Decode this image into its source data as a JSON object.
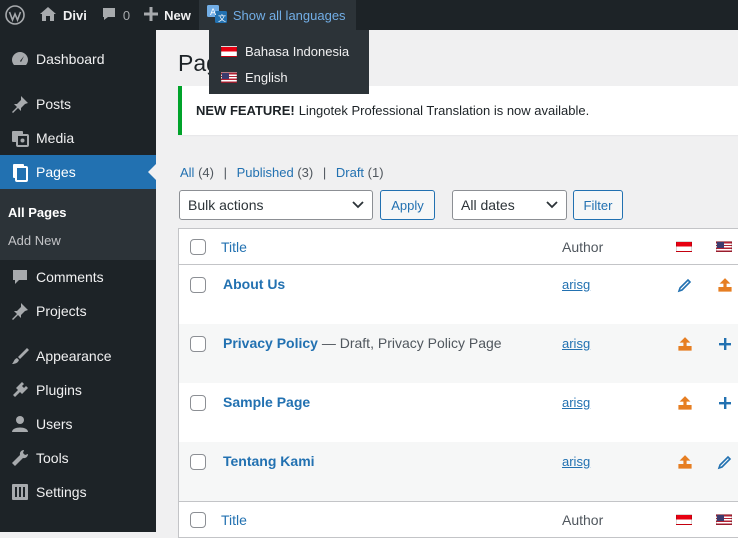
{
  "adminbar": {
    "site_name": "Divi",
    "comments_count": "0",
    "new_label": "New",
    "languages_label": "Show all languages",
    "language_options": [
      "Bahasa Indonesia",
      "English"
    ]
  },
  "sidebar": {
    "items": [
      {
        "label": "Dashboard",
        "icon": "dashboard-icon"
      },
      {
        "label": "Posts",
        "icon": "pin-icon"
      },
      {
        "label": "Media",
        "icon": "media-icon"
      },
      {
        "label": "Pages",
        "icon": "pages-icon"
      },
      {
        "label": "Comments",
        "icon": "comment-icon"
      },
      {
        "label": "Projects",
        "icon": "pin-icon"
      },
      {
        "label": "Appearance",
        "icon": "brush-icon"
      },
      {
        "label": "Plugins",
        "icon": "plugin-icon"
      },
      {
        "label": "Users",
        "icon": "user-icon"
      },
      {
        "label": "Tools",
        "icon": "wrench-icon"
      },
      {
        "label": "Settings",
        "icon": "settings-icon"
      }
    ],
    "submenu": [
      "All Pages",
      "Add New"
    ]
  },
  "main": {
    "title": "Pag",
    "notice": {
      "strong": "NEW FEATURE!",
      "text": "Lingotek Professional Translation is now available."
    },
    "filters": {
      "all": "All",
      "all_count": "(4)",
      "published": "Published",
      "published_count": "(3)",
      "draft": "Draft",
      "draft_count": "(1)",
      "separator": "|"
    },
    "bulk_actions": "Bulk actions",
    "apply": "Apply",
    "dates": "All dates",
    "filter": "Filter",
    "table": {
      "col_title": "Title",
      "col_author": "Author",
      "rows": [
        {
          "title": "About Us",
          "state": "",
          "author": "arisg",
          "id_icon": "pencil-icon",
          "en_icon": "upload-icon"
        },
        {
          "title": "Privacy Policy",
          "state": " — Draft, Privacy Policy Page",
          "author": "arisg",
          "id_icon": "upload-icon",
          "en_icon": "plus-icon"
        },
        {
          "title": "Sample Page",
          "state": "",
          "author": "arisg",
          "id_icon": "upload-icon",
          "en_icon": "plus-icon"
        },
        {
          "title": "Tentang Kami",
          "state": "",
          "author": "arisg",
          "id_icon": "upload-icon",
          "en_icon": "pencil-icon"
        }
      ]
    }
  },
  "colors": {
    "accent": "#2271b1",
    "upload": "#e67e22",
    "sidebar": "#1d2327",
    "notice": "#00a32a"
  }
}
